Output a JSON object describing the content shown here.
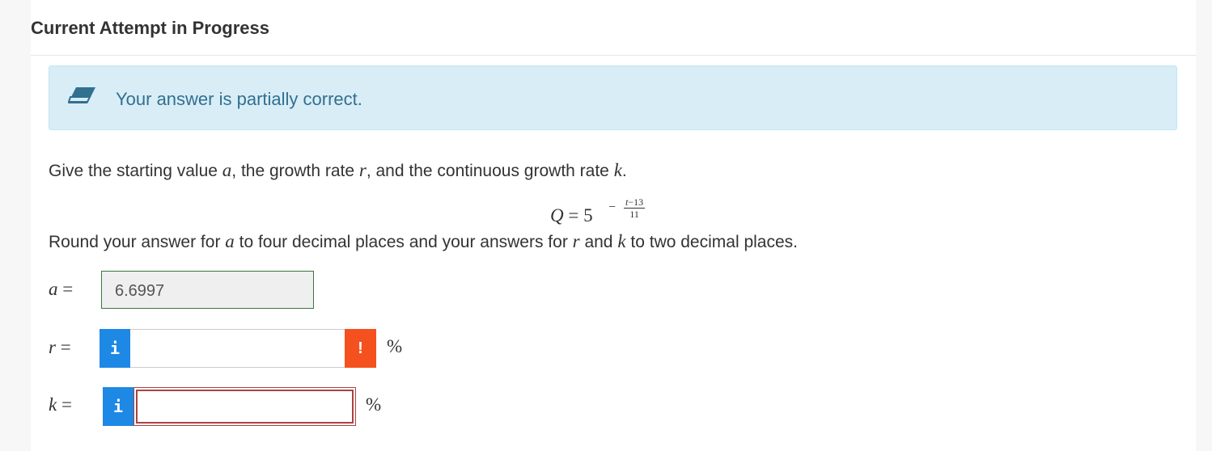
{
  "header": {
    "title": "Current Attempt in Progress"
  },
  "feedback": {
    "icon": "eraser-icon",
    "message": "Your answer is partially correct."
  },
  "question": {
    "text_before_a": "Give the starting value ",
    "var_a": "a",
    "text_before_r": ", the growth rate ",
    "var_r": "r",
    "text_before_k": ", and the continuous growth rate ",
    "var_k": "k",
    "text_end": "."
  },
  "equation": {
    "lhs": "Q",
    "equals": " = ",
    "base": "5",
    "exp_sign": "−",
    "exp_numerator_var": "t",
    "exp_numerator_rest": "−13",
    "exp_denominator": "11"
  },
  "instruction": {
    "part1": "Round your answer for ",
    "var_a": "a",
    "part2": " to four decimal places and your answers for ",
    "var_r": "r",
    "part3": " and ",
    "var_k": "k",
    "part4": " to two decimal places."
  },
  "answers": {
    "a": {
      "label_var": "a",
      "label_eq": " =",
      "value": "6.6997",
      "status": "correct"
    },
    "r": {
      "label_var": "r",
      "label_eq": " =",
      "value": "",
      "info": "i",
      "warn": "!",
      "unit": "%",
      "status": "warning"
    },
    "k": {
      "label_var": "k",
      "label_eq": " =",
      "value": "",
      "info": "i",
      "unit": "%",
      "status": "incorrect"
    }
  },
  "colors": {
    "alert_bg": "#d9edf7",
    "alert_text": "#31708f",
    "info_button": "#1e88e5",
    "warn_button": "#f4511e",
    "error_border": "#a94442",
    "correct_border": "#3c763d"
  }
}
